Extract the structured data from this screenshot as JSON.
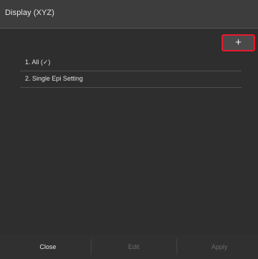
{
  "dialog": {
    "title": "Display (XYZ)",
    "add_label": "+"
  },
  "list": {
    "items": [
      {
        "label": "1. All (✓)"
      },
      {
        "label": "2. Single Epi Setting"
      }
    ]
  },
  "footer": {
    "close_label": "Close",
    "edit_label": "Edit",
    "apply_label": "Apply"
  },
  "colors": {
    "highlight_border": "#e8192c",
    "background": "#2e2e2e",
    "title_bar": "#3d3d3d",
    "disabled_text": "#6a6a6a"
  }
}
